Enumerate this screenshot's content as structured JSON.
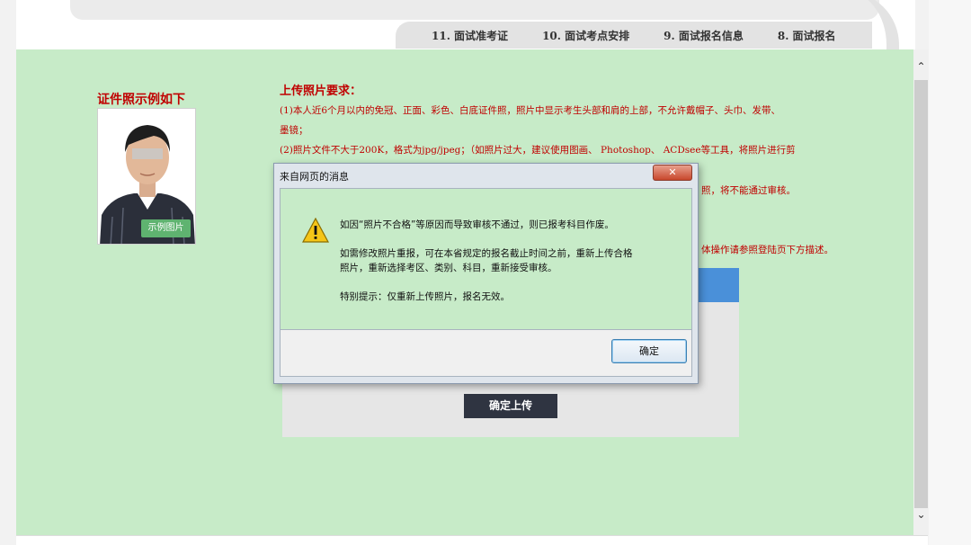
{
  "header": {
    "tabs": [
      {
        "label": "11. 面试准考证"
      },
      {
        "label": "10. 面试考点安排"
      },
      {
        "label": "9. 面试报名信息"
      },
      {
        "label": "8. 面试报名"
      }
    ]
  },
  "example": {
    "title": "证件照示例如下",
    "badge": "示例图片"
  },
  "requirements": {
    "title": "上传照片要求：",
    "line1": "(1)本人近6个月以内的免冠、正面、彩色、白底证件照，照片中显示考生头部和肩的上部，不允许戴帽子、头巾、发带、",
    "line2": "墨镜；",
    "line3": "(2)照片文件不大于200K，格式为jpg/jpeg；（如照片过大，建议使用图画、 Photoshop、 ACDsee等工具，将照片进行剪",
    "line4_tail": "照，将不能通过审核。",
    "line5_tail": "体操作请参照登陆页下方描述。"
  },
  "upload": {
    "button_label": "确定上传"
  },
  "dialog": {
    "title": "来自网页的消息",
    "close_label": "✕",
    "message1": "如因“照片不合格”等原因而导致审核不通过，则已报考科目作废。",
    "message2a": "如需修改照片重报，可在本省规定的报名截止时间之前，重新上传合格",
    "message2b": "照片，重新选择考区、类别、科目，重新接受审核。",
    "message3": "特别提示：仅重新上传照片，报名无效。",
    "ok_label": "确定",
    "icon": "warning-icon"
  },
  "scrollbar": {
    "up_glyph": "⌃",
    "down_glyph": "⌄"
  },
  "colors": {
    "page_green": "#c7ebc8",
    "warning_red": "#c00000",
    "upload_blue": "#4a90d9",
    "button_dark": "#2f3441"
  }
}
